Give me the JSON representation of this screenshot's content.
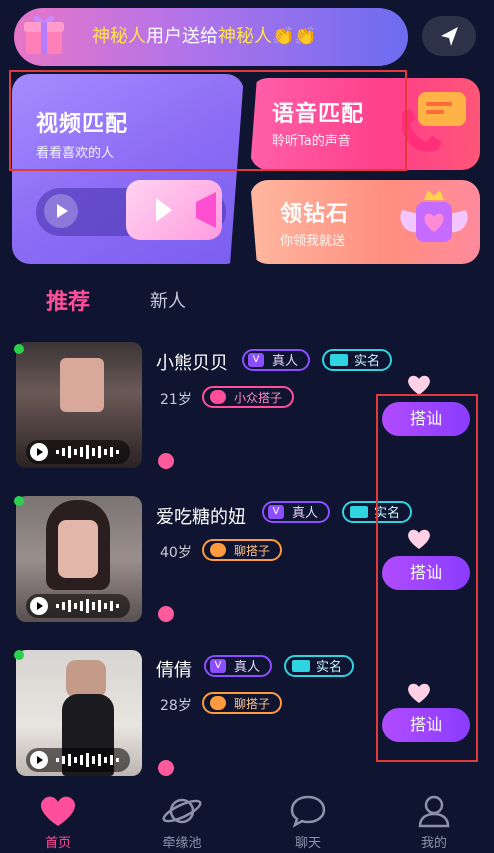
{
  "banner": {
    "part1": "神秘人",
    "part2": "用户送给",
    "part3": "神秘人",
    "emoji": "👏👏"
  },
  "cards": {
    "video": {
      "title": "视频匹配",
      "subtitle": "看看喜欢的人"
    },
    "voice": {
      "title": "语音匹配",
      "subtitle": "聆听Ta的声音"
    },
    "diamond": {
      "title": "领钻石",
      "subtitle": "你领我就送"
    }
  },
  "tabs": [
    {
      "label": "推荐",
      "active": true
    },
    {
      "label": "新人",
      "active": false
    }
  ],
  "users": [
    {
      "name": "小熊贝贝",
      "badge_real": "真人",
      "badge_id": "实名",
      "age": "21岁",
      "tag": "小众搭子",
      "action": "搭讪",
      "online": true
    },
    {
      "name": "爱吃糖的妞",
      "badge_real": "真人",
      "badge_id": "实名",
      "age": "40岁",
      "tag": "聊搭子",
      "action": "搭讪",
      "online": true
    },
    {
      "name": "倩倩",
      "badge_real": "真人",
      "badge_id": "实名",
      "age": "28岁",
      "tag": "聊搭子",
      "action": "搭讪",
      "online": true
    }
  ],
  "nav": [
    {
      "label": "首页",
      "icon": "heart-icon",
      "active": true
    },
    {
      "label": "牵缘池",
      "icon": "planet-icon",
      "active": false
    },
    {
      "label": "聊天",
      "icon": "chat-bubble-icon",
      "active": false
    },
    {
      "label": "我的",
      "icon": "person-icon",
      "active": false
    }
  ],
  "colors": {
    "background": "#0f1530",
    "accent_pink": "#ff4f9a",
    "accent_purple": "#8a3cff",
    "highlight_red": "#e23a3a"
  }
}
